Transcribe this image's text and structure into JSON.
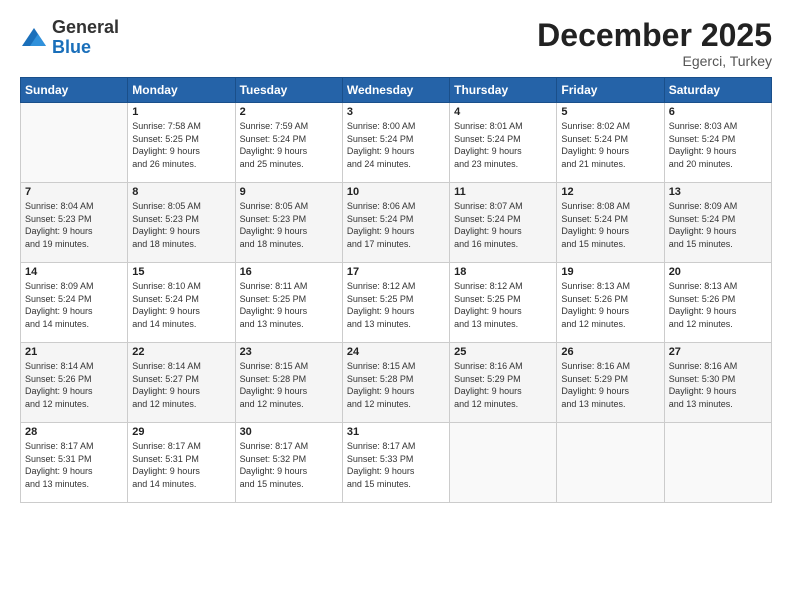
{
  "logo": {
    "general": "General",
    "blue": "Blue"
  },
  "header": {
    "month": "December 2025",
    "location": "Egerci, Turkey"
  },
  "weekdays": [
    "Sunday",
    "Monday",
    "Tuesday",
    "Wednesday",
    "Thursday",
    "Friday",
    "Saturday"
  ],
  "weeks": [
    [
      {
        "day": "",
        "info": ""
      },
      {
        "day": "1",
        "info": "Sunrise: 7:58 AM\nSunset: 5:25 PM\nDaylight: 9 hours\nand 26 minutes."
      },
      {
        "day": "2",
        "info": "Sunrise: 7:59 AM\nSunset: 5:24 PM\nDaylight: 9 hours\nand 25 minutes."
      },
      {
        "day": "3",
        "info": "Sunrise: 8:00 AM\nSunset: 5:24 PM\nDaylight: 9 hours\nand 24 minutes."
      },
      {
        "day": "4",
        "info": "Sunrise: 8:01 AM\nSunset: 5:24 PM\nDaylight: 9 hours\nand 23 minutes."
      },
      {
        "day": "5",
        "info": "Sunrise: 8:02 AM\nSunset: 5:24 PM\nDaylight: 9 hours\nand 21 minutes."
      },
      {
        "day": "6",
        "info": "Sunrise: 8:03 AM\nSunset: 5:24 PM\nDaylight: 9 hours\nand 20 minutes."
      }
    ],
    [
      {
        "day": "7",
        "info": "Sunrise: 8:04 AM\nSunset: 5:23 PM\nDaylight: 9 hours\nand 19 minutes."
      },
      {
        "day": "8",
        "info": "Sunrise: 8:05 AM\nSunset: 5:23 PM\nDaylight: 9 hours\nand 18 minutes."
      },
      {
        "day": "9",
        "info": "Sunrise: 8:05 AM\nSunset: 5:23 PM\nDaylight: 9 hours\nand 18 minutes."
      },
      {
        "day": "10",
        "info": "Sunrise: 8:06 AM\nSunset: 5:24 PM\nDaylight: 9 hours\nand 17 minutes."
      },
      {
        "day": "11",
        "info": "Sunrise: 8:07 AM\nSunset: 5:24 PM\nDaylight: 9 hours\nand 16 minutes."
      },
      {
        "day": "12",
        "info": "Sunrise: 8:08 AM\nSunset: 5:24 PM\nDaylight: 9 hours\nand 15 minutes."
      },
      {
        "day": "13",
        "info": "Sunrise: 8:09 AM\nSunset: 5:24 PM\nDaylight: 9 hours\nand 15 minutes."
      }
    ],
    [
      {
        "day": "14",
        "info": "Sunrise: 8:09 AM\nSunset: 5:24 PM\nDaylight: 9 hours\nand 14 minutes."
      },
      {
        "day": "15",
        "info": "Sunrise: 8:10 AM\nSunset: 5:24 PM\nDaylight: 9 hours\nand 14 minutes."
      },
      {
        "day": "16",
        "info": "Sunrise: 8:11 AM\nSunset: 5:25 PM\nDaylight: 9 hours\nand 13 minutes."
      },
      {
        "day": "17",
        "info": "Sunrise: 8:12 AM\nSunset: 5:25 PM\nDaylight: 9 hours\nand 13 minutes."
      },
      {
        "day": "18",
        "info": "Sunrise: 8:12 AM\nSunset: 5:25 PM\nDaylight: 9 hours\nand 13 minutes."
      },
      {
        "day": "19",
        "info": "Sunrise: 8:13 AM\nSunset: 5:26 PM\nDaylight: 9 hours\nand 12 minutes."
      },
      {
        "day": "20",
        "info": "Sunrise: 8:13 AM\nSunset: 5:26 PM\nDaylight: 9 hours\nand 12 minutes."
      }
    ],
    [
      {
        "day": "21",
        "info": "Sunrise: 8:14 AM\nSunset: 5:26 PM\nDaylight: 9 hours\nand 12 minutes."
      },
      {
        "day": "22",
        "info": "Sunrise: 8:14 AM\nSunset: 5:27 PM\nDaylight: 9 hours\nand 12 minutes."
      },
      {
        "day": "23",
        "info": "Sunrise: 8:15 AM\nSunset: 5:28 PM\nDaylight: 9 hours\nand 12 minutes."
      },
      {
        "day": "24",
        "info": "Sunrise: 8:15 AM\nSunset: 5:28 PM\nDaylight: 9 hours\nand 12 minutes."
      },
      {
        "day": "25",
        "info": "Sunrise: 8:16 AM\nSunset: 5:29 PM\nDaylight: 9 hours\nand 12 minutes."
      },
      {
        "day": "26",
        "info": "Sunrise: 8:16 AM\nSunset: 5:29 PM\nDaylight: 9 hours\nand 13 minutes."
      },
      {
        "day": "27",
        "info": "Sunrise: 8:16 AM\nSunset: 5:30 PM\nDaylight: 9 hours\nand 13 minutes."
      }
    ],
    [
      {
        "day": "28",
        "info": "Sunrise: 8:17 AM\nSunset: 5:31 PM\nDaylight: 9 hours\nand 13 minutes."
      },
      {
        "day": "29",
        "info": "Sunrise: 8:17 AM\nSunset: 5:31 PM\nDaylight: 9 hours\nand 14 minutes."
      },
      {
        "day": "30",
        "info": "Sunrise: 8:17 AM\nSunset: 5:32 PM\nDaylight: 9 hours\nand 15 minutes."
      },
      {
        "day": "31",
        "info": "Sunrise: 8:17 AM\nSunset: 5:33 PM\nDaylight: 9 hours\nand 15 minutes."
      },
      {
        "day": "",
        "info": ""
      },
      {
        "day": "",
        "info": ""
      },
      {
        "day": "",
        "info": ""
      }
    ]
  ]
}
